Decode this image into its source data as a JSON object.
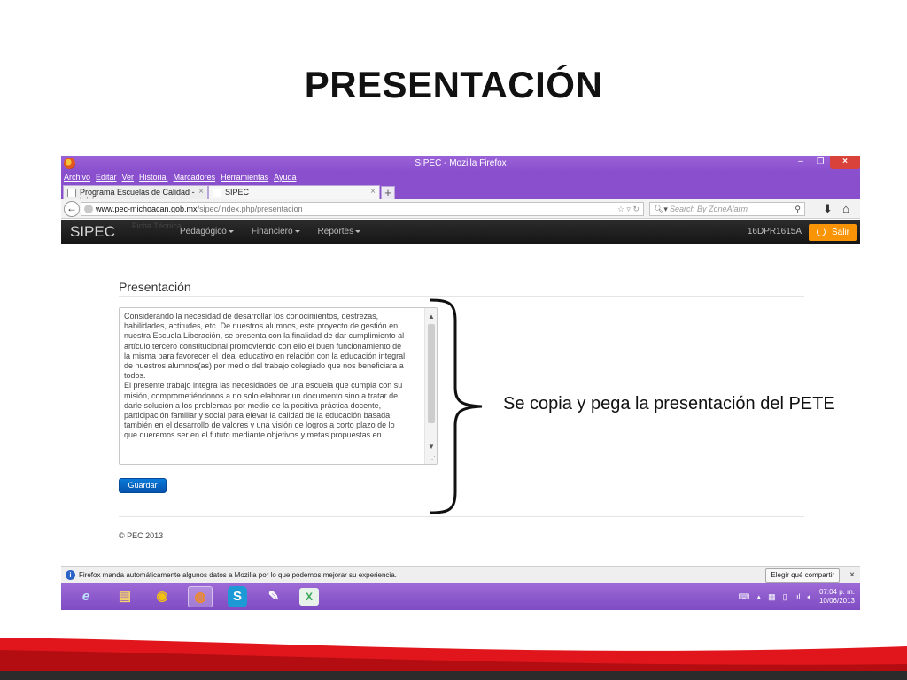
{
  "slide": {
    "title": "PRESENTACIÓN",
    "annotation": "Se copia y pega la presentación del PETE"
  },
  "browser": {
    "window_title": "SIPEC - Mozilla Firefox",
    "menu": [
      "Archivo",
      "Editar",
      "Ver",
      "Historial",
      "Marcadores",
      "Herramientas",
      "Ayuda"
    ],
    "tabs": [
      {
        "label": "Programa Escuelas de Calidad - Inicio"
      },
      {
        "label": "SIPEC"
      }
    ],
    "url_host": "www.pec-michoacan.gob.mx",
    "url_path": "/sipec/index.php/presentacion",
    "search_placeholder": "Search By ZoneAlarm"
  },
  "app": {
    "brand": "SIPEC",
    "brand_sub": "Ficha Técnica",
    "nav": [
      "Pedagógico",
      "Financiero",
      "Reportes"
    ],
    "user_code": "16DPR1615A",
    "logout_label": "Salir",
    "page_heading": "Presentación",
    "textarea_content": "Considerando la necesidad de desarrollar los conocimientos, destrezas,\nhabilidades, actitudes, etc. De nuestros alumnos, este proyecto de gestión en\nnuestra Escuela Liberación, se presenta con la finalidad de dar cumplimiento al\nartículo tercero constitucional promoviendo con ello el buen funcionamiento de\nla misma para favorecer el ideal educativo en relación con la educación integral\nde nuestros alumnos(as) por medio del trabajo colegiado que nos beneficiara a\ntodos.\nEl presente trabajo integra las necesidades de una escuela que cumpla con su\nmisión, comprometiéndonos a no solo elaborar un documento sino a tratar de\ndarle solución a los problemas por medio de la positiva práctica docente,\nparticipación familiar y social para elevar la calidad de la educación basada\ntambién en el desarrollo de valores y una visión de logros a corto plazo de lo\nque queremos ser en el fututo mediante objetivos y metas propuestas en",
    "save_label": "Guardar",
    "footer": "© PEC 2013"
  },
  "notification": {
    "text": "Firefox manda automáticamente algunos datos a Mozilla por lo que podemos mejorar su experiencia.",
    "button": "Elegir qué compartir",
    "close": "×"
  },
  "taskbar": {
    "time": "07:04 p. m.",
    "date": "10/06/2013"
  },
  "colors": {
    "firefox_purple": "#8a4fcd",
    "salir_orange": "#f89406",
    "guardar_blue": "#0a6fd0",
    "deco_red": "#e0161c"
  }
}
